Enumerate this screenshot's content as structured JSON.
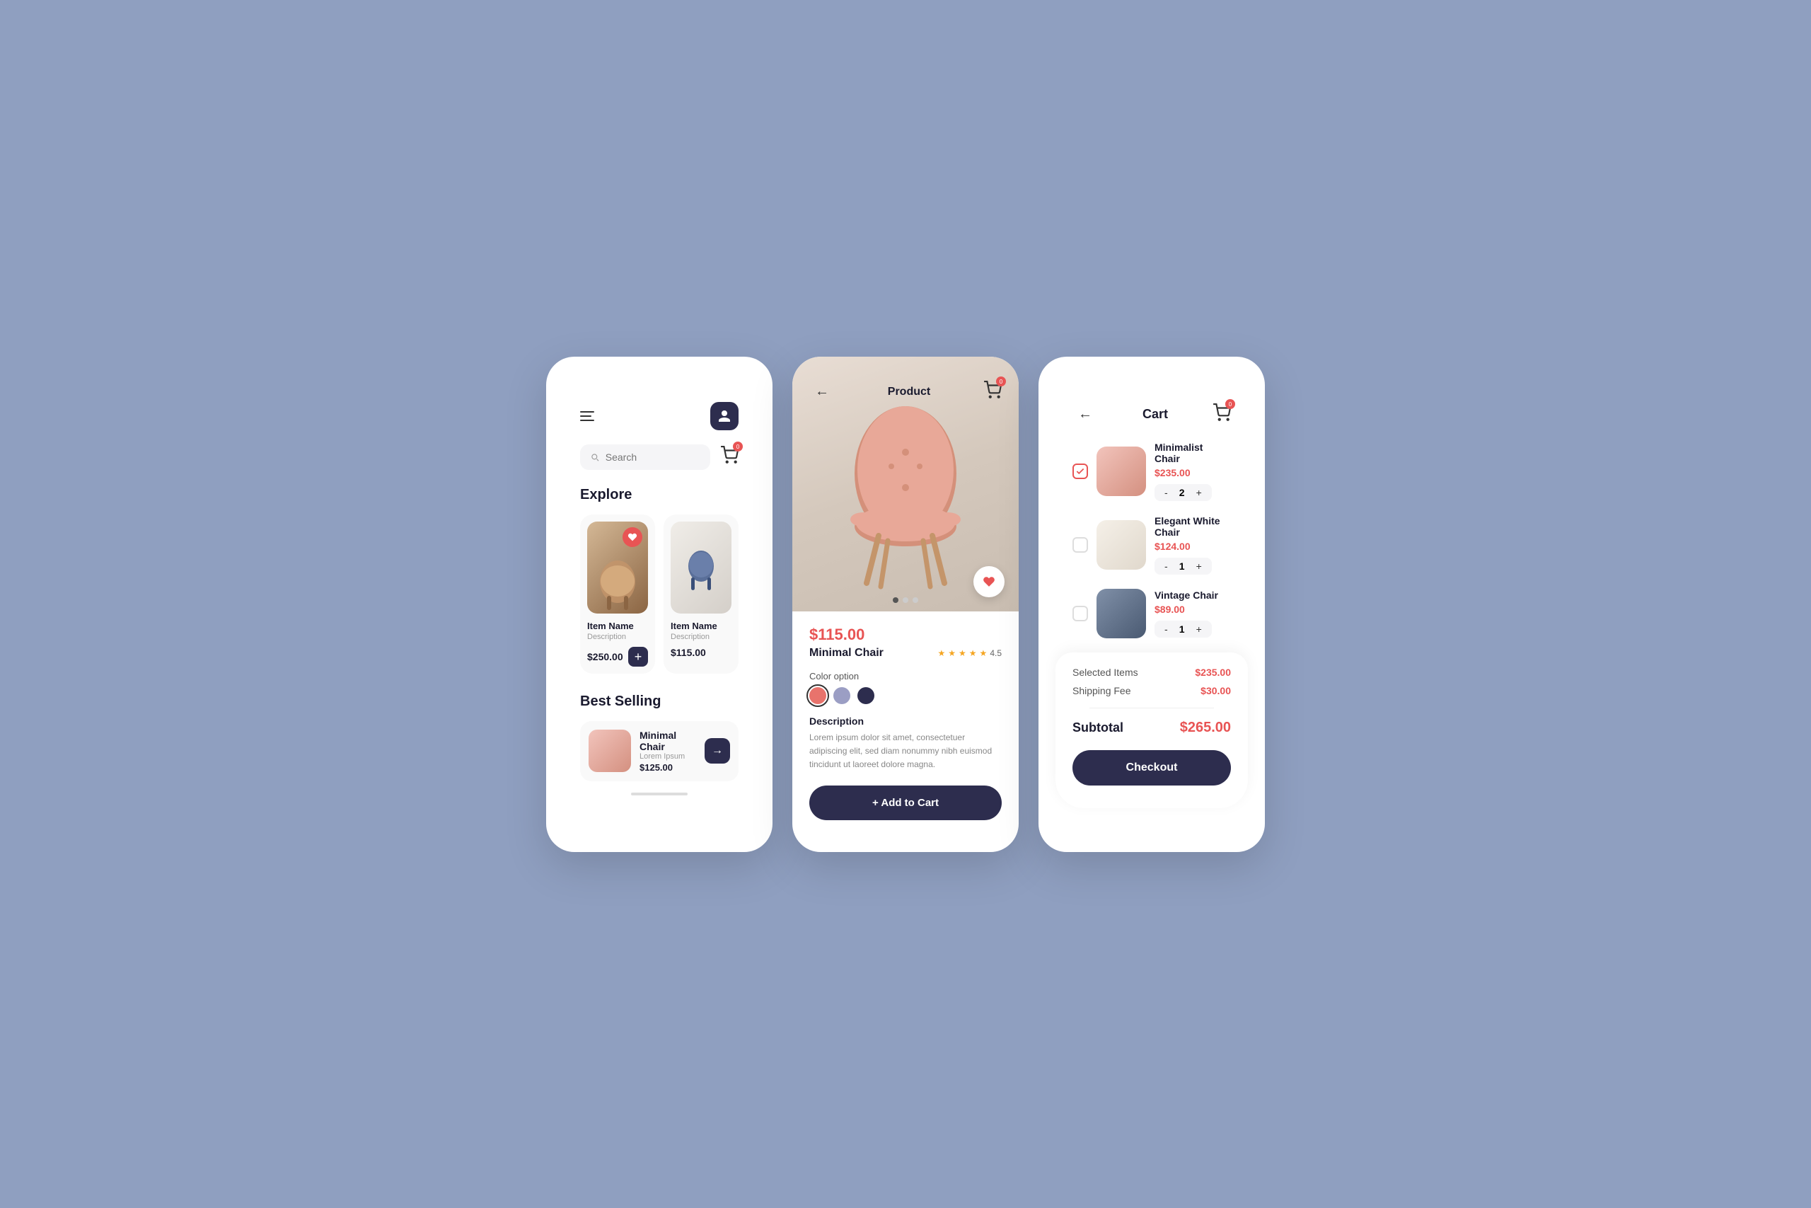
{
  "screen1": {
    "search_placeholder": "Search",
    "cart_badge": "0",
    "explore_title": "Explore",
    "card1": {
      "name": "Item Name",
      "desc": "Description",
      "price": "$250.00"
    },
    "card2": {
      "name": "Item Name",
      "desc": "Description",
      "price": "$115.00"
    },
    "best_selling_title": "Best Selling",
    "best1": {
      "name": "Minimal Chair",
      "desc": "Lorem Ipsum",
      "price": "$125.00"
    }
  },
  "screen2": {
    "header_title": "Product",
    "price": "$115.00",
    "name": "Minimal Chair",
    "rating": "4.5",
    "color_label": "Color option",
    "colors": [
      "#e8736c",
      "#9b9ec4",
      "#2d2d4e"
    ],
    "desc_label": "Description",
    "desc_text": "Lorem ipsum dolor sit amet, consectetuer adipiscing elit, sed diam nonummy nibh euismod tincidunt ut laoreet dolore magna.",
    "add_to_cart_label": "+ Add to Cart"
  },
  "screen3": {
    "header_title": "Cart",
    "cart_badge": "0",
    "item1": {
      "name": "Minimalist Chair",
      "price": "$235.00",
      "qty": "2",
      "checked": true
    },
    "item2": {
      "name": "Elegant White Chair",
      "price": "$124.00",
      "qty": "1",
      "checked": false
    },
    "item3": {
      "name": "Vintage Chair",
      "price": "$89.00",
      "qty": "1",
      "checked": false
    },
    "selected_items_label": "Selected Items",
    "selected_items_value": "$235.00",
    "shipping_label": "Shipping Fee",
    "shipping_value": "$30.00",
    "subtotal_label": "Subtotal",
    "subtotal_value": "$265.00",
    "checkout_label": "Checkout"
  }
}
